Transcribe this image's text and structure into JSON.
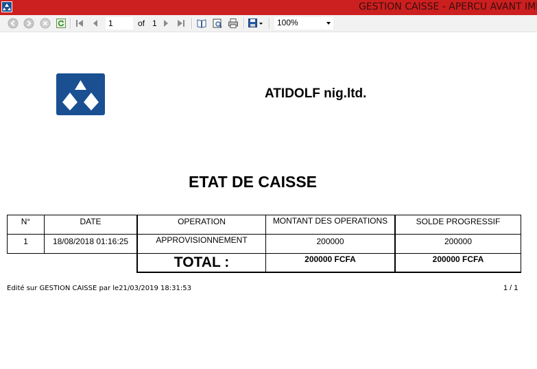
{
  "window": {
    "title": "GESTION CAISSE - APERCU AVANT IMP"
  },
  "toolbar": {
    "current_page": "1",
    "of_label": "of",
    "total_pages": "1",
    "zoom": "100%",
    "icons": [
      "back-icon",
      "forward-icon",
      "stop-icon",
      "refresh-icon",
      "first-page-icon",
      "previous-page-icon",
      "next-page-icon",
      "last-page-icon",
      "print-layout-icon",
      "page-setup-icon",
      "print-icon",
      "export-icon",
      "zoom-dropdown-arrow"
    ]
  },
  "report": {
    "company": "ATIDOLF nig.ltd.",
    "title": "ETAT DE CAISSE",
    "columns": [
      "N°",
      "DATE",
      "OPERATION",
      "MONTANT DES OPERATIONS",
      "SOLDE PROGRESSIF"
    ],
    "rows": [
      {
        "num": "1",
        "date": "18/08/2018 01:16:25",
        "operation": "APPROVISIONNEMENT",
        "montant": "200000",
        "solde": "200000"
      }
    ],
    "total_label": "TOTAL :",
    "total_montant": "200000 FCFA",
    "total_solde": "200000 FCFA",
    "footer_left": "Edité sur GESTION CAISSE par  le21/03/2019 18:31:53",
    "footer_right": "1 / 1"
  },
  "colors": {
    "titlebar": "#cc1f1f",
    "logo": "#1a4f92"
  }
}
